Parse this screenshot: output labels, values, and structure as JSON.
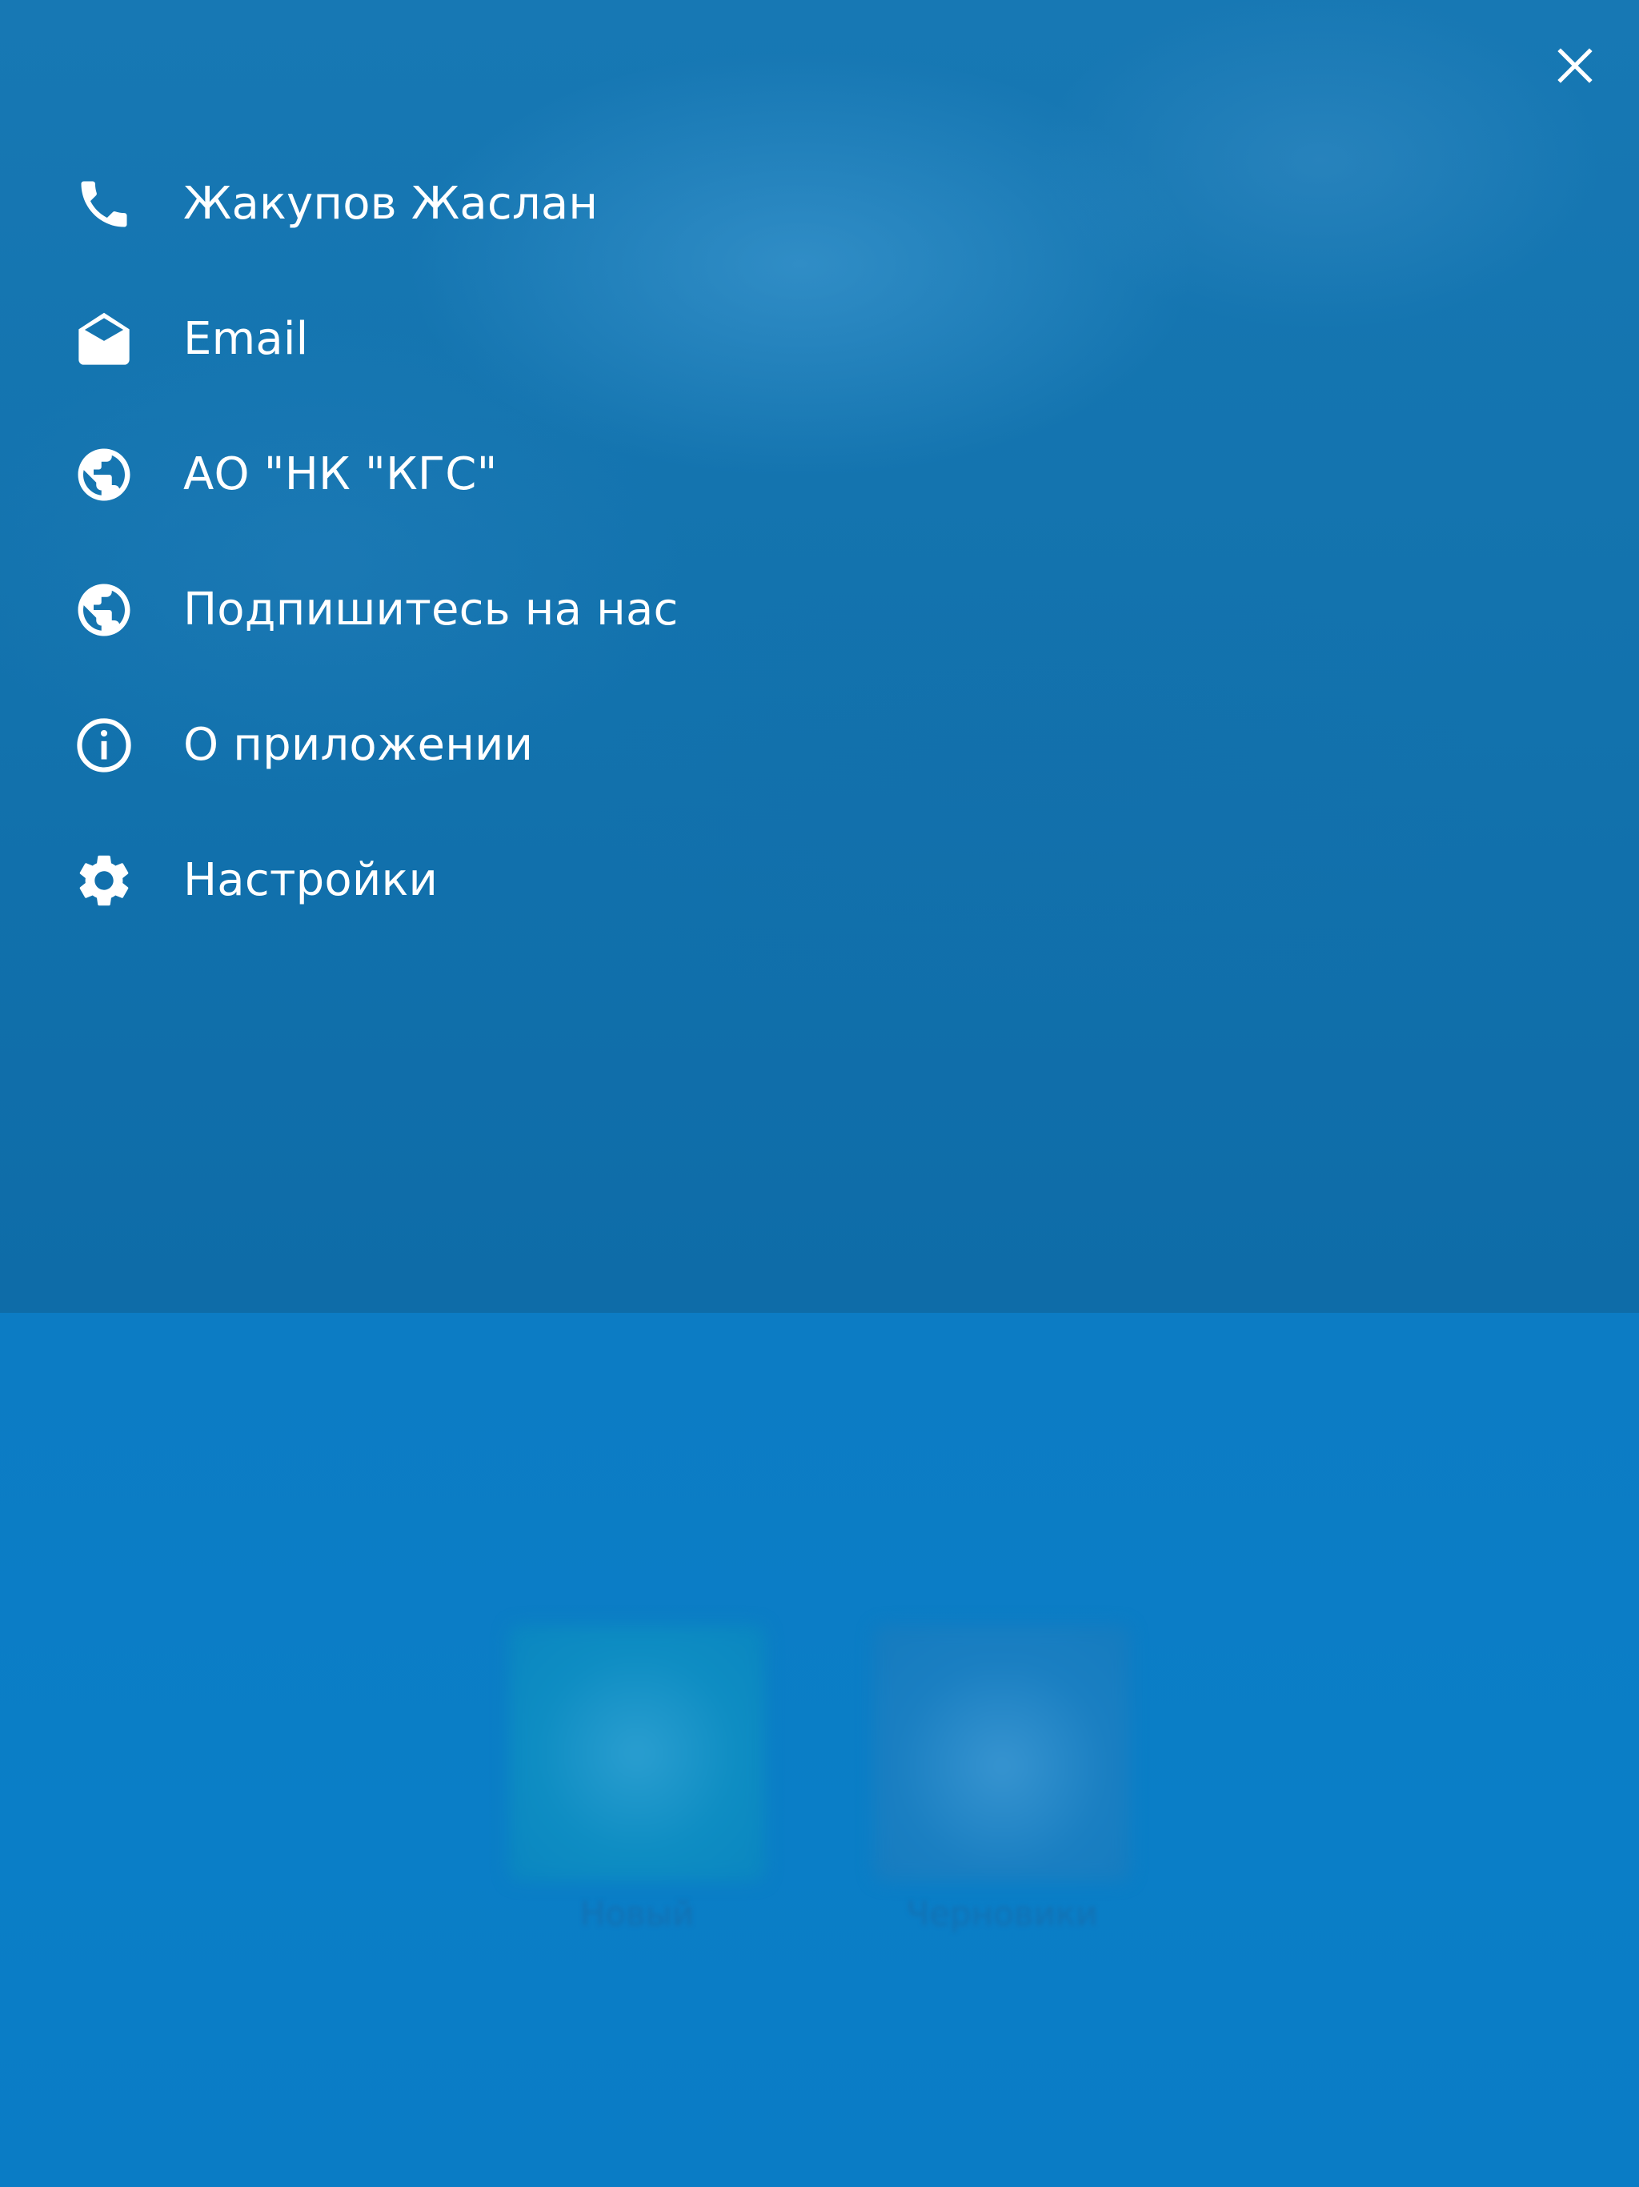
{
  "menu": {
    "close_icon": "close-icon",
    "items": [
      {
        "label": "Жакупов Жаслан",
        "icon": "phone-icon"
      },
      {
        "label": "Email",
        "icon": "envelope-open-icon"
      },
      {
        "label": "АО \"НК \"КГС\"",
        "icon": "globe-icon"
      },
      {
        "label": "Подпишитесь на нас",
        "icon": "globe-icon"
      },
      {
        "label": "О приложении",
        "icon": "info-icon"
      },
      {
        "label": "Настройки",
        "icon": "gear-icon"
      }
    ]
  },
  "background": {
    "tiles": [
      {
        "label": "Новый"
      },
      {
        "label": "Черновики"
      }
    ]
  },
  "colors": {
    "overlay_top": "#1373ae",
    "background_bottom": "#0a7ec7",
    "text": "#ffffff"
  }
}
